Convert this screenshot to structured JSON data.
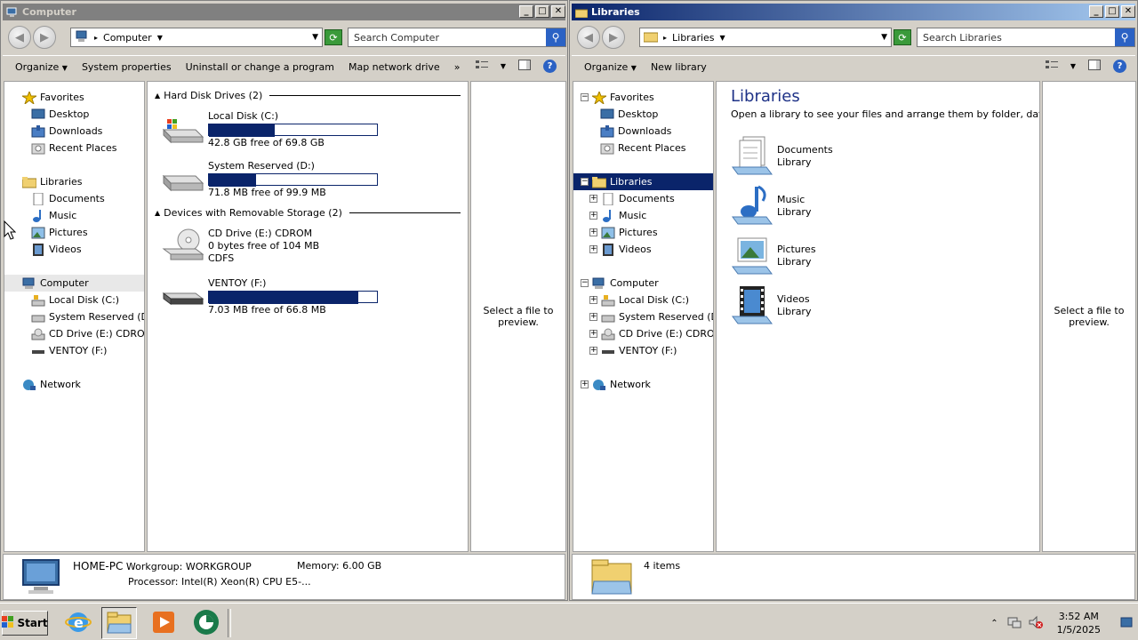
{
  "left_window": {
    "title": "Computer",
    "address": {
      "root_icon": "computer-icon",
      "segment": "Computer"
    },
    "search_placeholder": "Search Computer",
    "toolbar": [
      "Organize",
      "System properties",
      "Uninstall or change a program",
      "Map network drive",
      "»"
    ],
    "nav": {
      "favorites": "Favorites",
      "favorites_items": [
        "Desktop",
        "Downloads",
        "Recent Places"
      ],
      "libraries": "Libraries",
      "libraries_items": [
        "Documents",
        "Music",
        "Pictures",
        "Videos"
      ],
      "computer": "Computer",
      "computer_items": [
        "Local Disk (C:)",
        "System Reserved (D:)",
        "CD Drive (E:) CDROM",
        "VENTOY (F:)"
      ],
      "network": "Network"
    },
    "groups": {
      "hdd": "Hard Disk Drives (2)",
      "removable": "Devices with Removable Storage (2)"
    },
    "drives": [
      {
        "name": "Local Disk (C:)",
        "free": "42.8 GB free of 69.8 GB",
        "used_fraction": 0.39
      },
      {
        "name": "System Reserved (D:)",
        "free": "71.8 MB free of 99.9 MB",
        "used_fraction": 0.28
      },
      {
        "name": "CD Drive (E:) CDROM",
        "free": "0 bytes free of 104 MB",
        "fs": "CDFS"
      },
      {
        "name": "VENTOY (F:)",
        "free": "7.03 MB free of 66.8 MB",
        "used_fraction": 0.89
      }
    ],
    "preview": "Select a file to preview.",
    "details": {
      "pc_name": "HOME-PC",
      "workgroup_label": "Workgroup:",
      "workgroup": "WORKGROUP",
      "memory_label": "Memory:",
      "memory": "6.00 GB",
      "processor_label": "Processor:",
      "processor": "Intel(R) Xeon(R) CPU E5-..."
    }
  },
  "right_window": {
    "title": "Libraries",
    "address": {
      "segment": "Libraries"
    },
    "search_placeholder": "Search Libraries",
    "toolbar": [
      "Organize",
      "New library"
    ],
    "nav": {
      "favorites": "Favorites",
      "favorites_items": [
        "Desktop",
        "Downloads",
        "Recent Places"
      ],
      "libraries": "Libraries",
      "libraries_items": [
        "Documents",
        "Music",
        "Pictures",
        "Videos"
      ],
      "computer": "Computer",
      "computer_items": [
        "Local Disk (C:)",
        "System Reserved (D:)",
        "CD Drive (E:) CDROM",
        "VENTOY (F:)"
      ],
      "network": "Network"
    },
    "heading": "Libraries",
    "subheading": "Open a library to see your files and arrange them by folder, dat...",
    "libraries": [
      {
        "name": "Documents",
        "type": "Library"
      },
      {
        "name": "Music",
        "type": "Library"
      },
      {
        "name": "Pictures",
        "type": "Library"
      },
      {
        "name": "Videos",
        "type": "Library"
      }
    ],
    "preview": "Select a file to preview.",
    "details": {
      "count": "4 items"
    }
  },
  "taskbar": {
    "start": "Start",
    "time": "3:52 AM",
    "date": "1/5/2025"
  },
  "colors": {
    "selection": "#0a246a",
    "active_title": "#0a246a",
    "inactive_title": "#808080"
  }
}
